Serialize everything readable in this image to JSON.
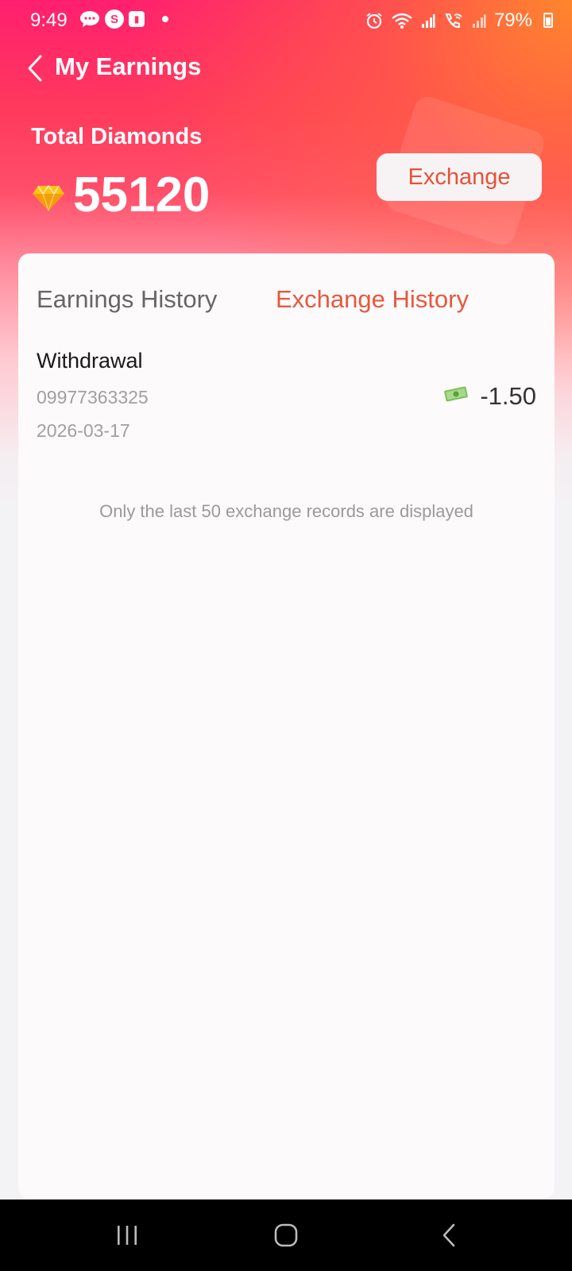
{
  "status_bar": {
    "time": "9:49",
    "battery": "79%",
    "notif_icons": [
      "chat-icon",
      "s-app-icon",
      "media-icon"
    ],
    "right_icons": [
      "alarm-icon",
      "wifi-icon",
      "signal-icon",
      "wifi-call-icon",
      "signal-icon"
    ]
  },
  "header": {
    "title": "My Earnings"
  },
  "diamonds": {
    "label": "Total Diamonds",
    "value": "55120",
    "exchange_label": "Exchange"
  },
  "tabs": [
    {
      "label": "Earnings History",
      "active": false
    },
    {
      "label": "Exchange History",
      "active": true
    }
  ],
  "records": [
    {
      "type": "Withdrawal",
      "account": "09977363325",
      "date": "2026-03-17",
      "amount": "-1.50"
    }
  ],
  "footer_note": "Only the last 50 exchange records are displayed",
  "colors": {
    "accent": "#e8583e",
    "header_pink": "#ff1f6e",
    "header_orange": "#ff8a28"
  }
}
